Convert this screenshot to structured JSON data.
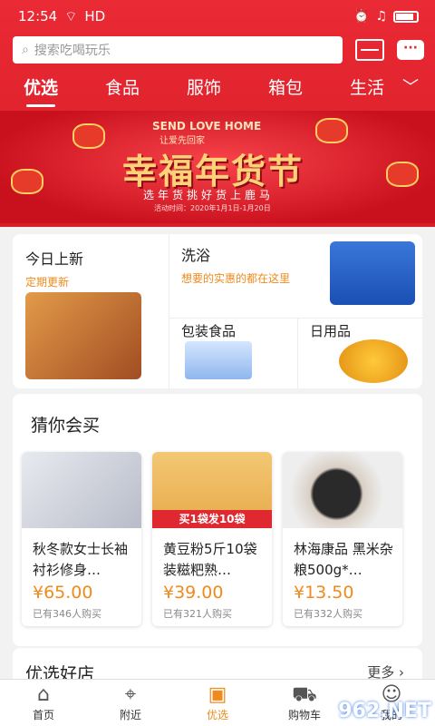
{
  "status": {
    "time": "12:54",
    "network": "HD"
  },
  "search": {
    "placeholder": "搜索吃喝玩乐"
  },
  "tabs": [
    {
      "label": "优选"
    },
    {
      "label": "食品"
    },
    {
      "label": "服饰"
    },
    {
      "label": "箱包"
    },
    {
      "label": "生活"
    }
  ],
  "banner": {
    "en": "SEND LOVE HOME",
    "sub_en": "让爱先回家",
    "title": "幸福年货节",
    "subtitle": "选年货挑好货上鹿马",
    "date": "活动时间：2020年1月1日-1月20日"
  },
  "categories": {
    "today_new": {
      "title": "今日上新",
      "sub": "定期更新"
    },
    "bath": {
      "title": "洗浴",
      "sub": "想要的实惠的都在这里"
    },
    "packaged": {
      "title": "包装食品"
    },
    "daily": {
      "title": "日用品"
    }
  },
  "recommend": {
    "title": "猜你会买",
    "products": [
      {
        "name": "秋冬款女士长袖衬衫修身…",
        "price": "¥65.00",
        "count": "已有346人购买"
      },
      {
        "name": "黄豆粉5斤10袋装糍粑熟…",
        "price": "¥39.00",
        "count": "已有321人购买"
      },
      {
        "name": "林海康品 黑米杂粮500g*…",
        "price": "¥13.50",
        "count": "已有332人购买"
      }
    ],
    "promo": "买1袋发10袋"
  },
  "shops": {
    "title": "优选好店",
    "more": "更多"
  },
  "nav": [
    {
      "label": "首页",
      "icon": "home-icon"
    },
    {
      "label": "附近",
      "icon": "location-icon"
    },
    {
      "label": "优选",
      "icon": "bag-icon"
    },
    {
      "label": "购物车",
      "icon": "cart-icon"
    },
    {
      "label": "我的",
      "icon": "user-icon"
    }
  ],
  "watermark": "962.NET",
  "colors": {
    "brand_red": "#e02830",
    "accent_orange": "#f08a1c"
  }
}
